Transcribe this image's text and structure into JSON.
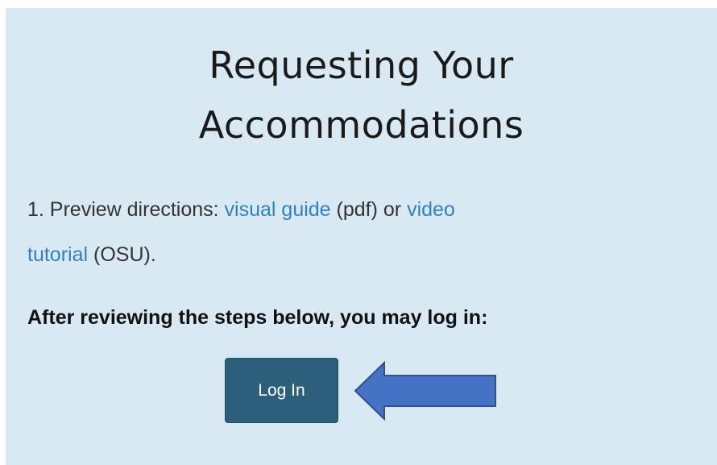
{
  "page": {
    "title_line1": "Requesting Your",
    "title_line2": "Accommodations"
  },
  "step1": {
    "prefix": "1.  Preview directions: ",
    "visual_guide_link": "visual guide",
    "pdf_note": " (pdf) or ",
    "video_link_part1": "video",
    "video_link_part2": "tutorial",
    "osu_note": " (OSU)."
  },
  "login": {
    "instruction": "After reviewing the steps below, you may log in:",
    "button_label": "Log In"
  },
  "colors": {
    "panel_bg": "#d9e9f3",
    "link": "#2f82bf",
    "button_bg": "#2c5f7a",
    "arrow_fill": "#4472c4",
    "arrow_stroke": "#2f528f"
  },
  "icons": {
    "arrow": "arrow-left-icon"
  }
}
